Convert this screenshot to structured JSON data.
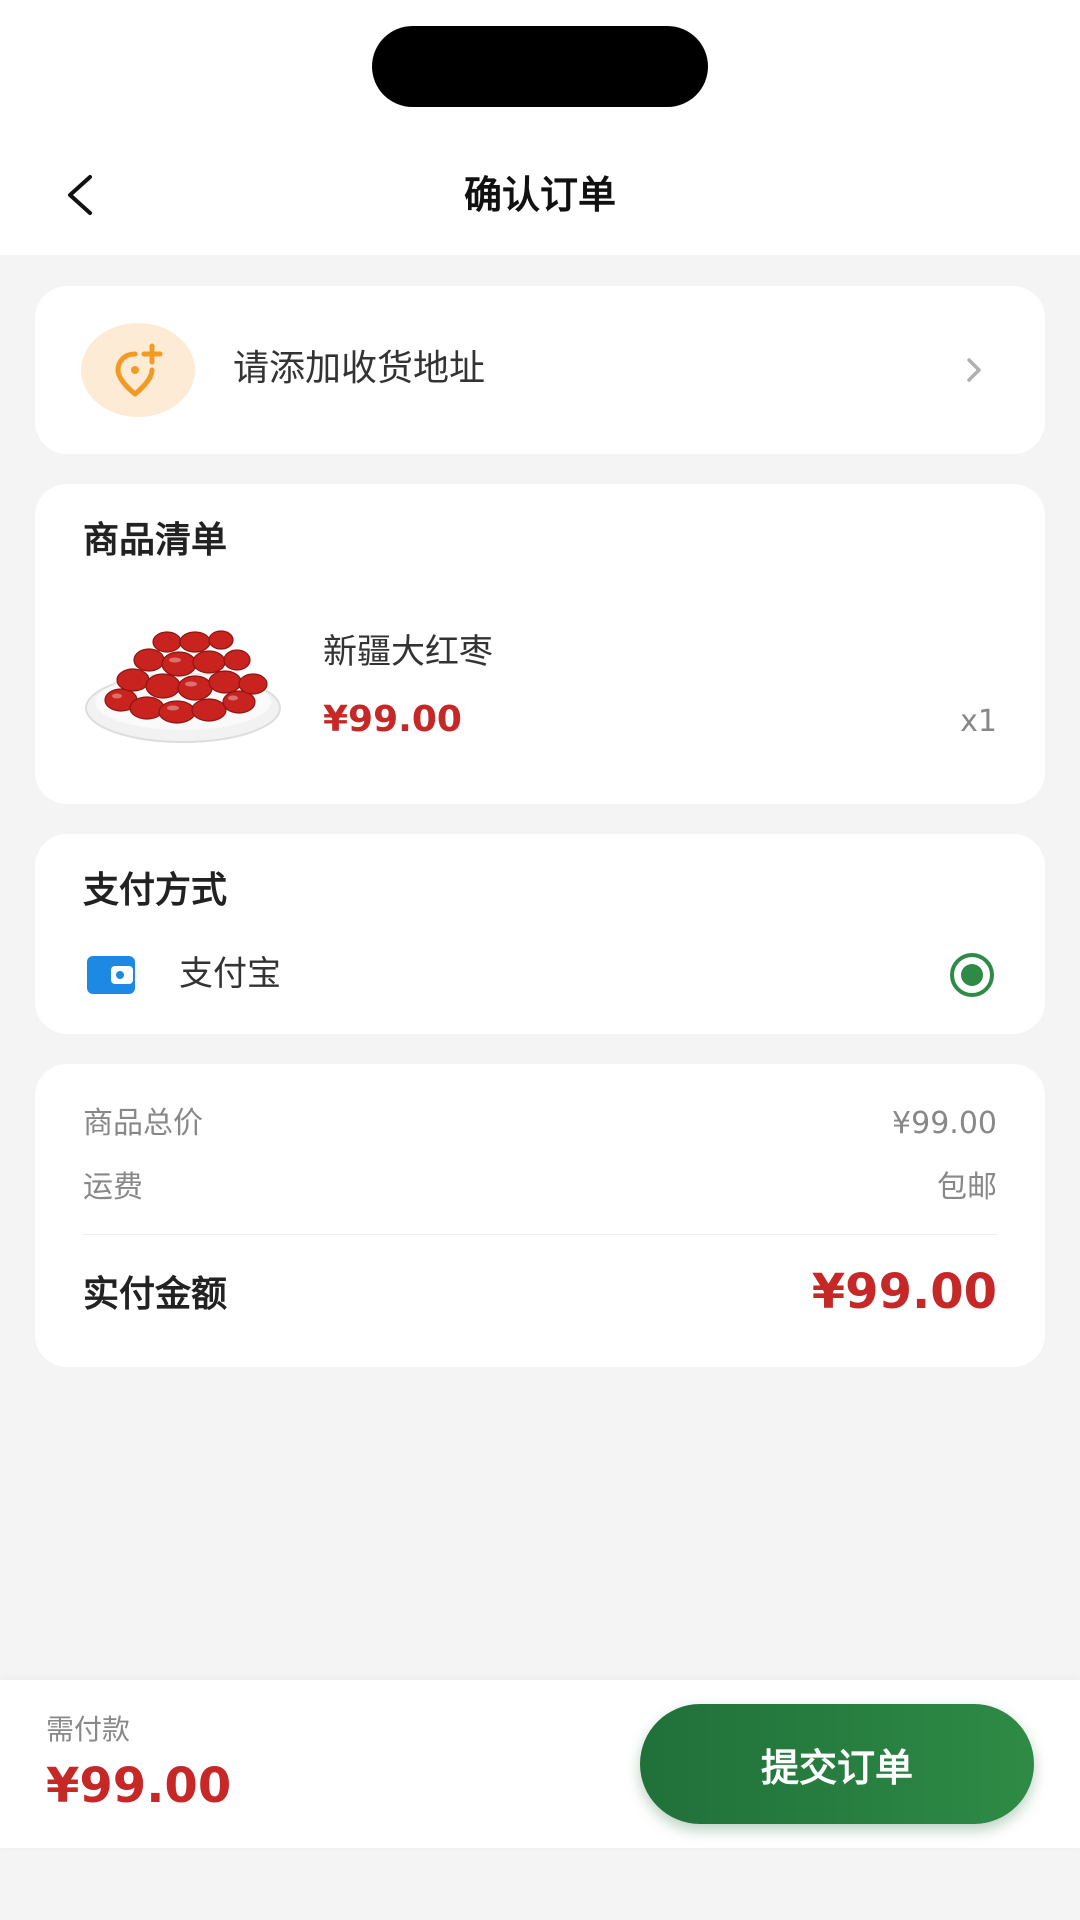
{
  "header": {
    "title": "确认订单",
    "back_icon": "chevron-left-icon"
  },
  "address": {
    "prompt": "请添加收货地址",
    "icon": "add-location-icon",
    "chevron_icon": "chevron-right-icon"
  },
  "goods": {
    "section_title": "商品清单",
    "items": [
      {
        "name": "新疆大红枣",
        "price": "¥99.00",
        "quantity": "x1",
        "image": "red-dates-image"
      }
    ]
  },
  "payment": {
    "section_title": "支付方式",
    "method_label": "支付宝",
    "method_icon": "wallet-icon",
    "selected": true
  },
  "summary": {
    "subtotal_label": "商品总价",
    "subtotal_value": "¥99.00",
    "shipping_label": "运费",
    "shipping_value": "包邮",
    "total_label": "实付金额",
    "total_value": "¥99.00"
  },
  "footer": {
    "need_pay_label": "需付款",
    "need_pay_value": "¥99.00",
    "submit_label": "提交订单"
  },
  "colors": {
    "accent_green": "#2e8b45",
    "price_red": "#c62828",
    "address_icon_orange": "#f29b24",
    "alipay_blue": "#1e88e5"
  }
}
